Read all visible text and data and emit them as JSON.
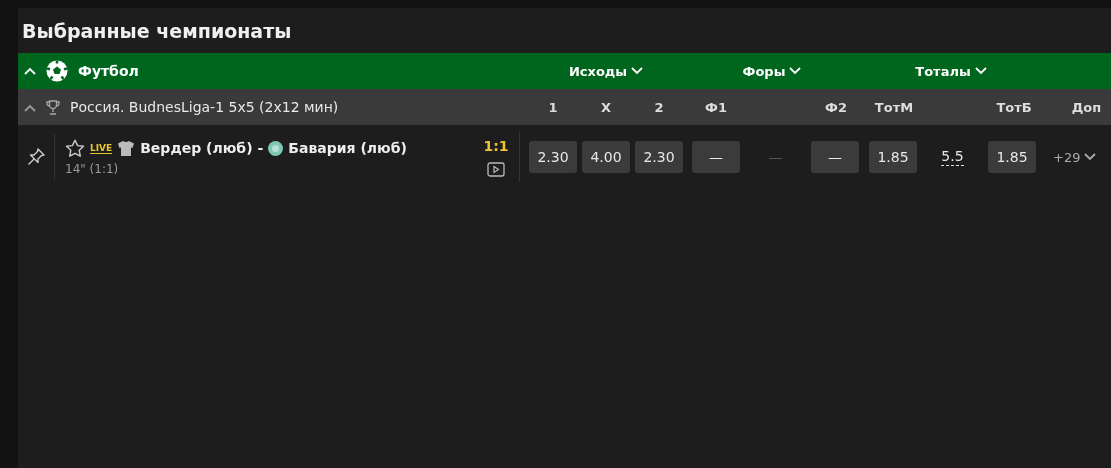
{
  "title": "Выбранные чемпионаты",
  "sport": {
    "name": "Футбол",
    "expanded": true
  },
  "markets": [
    {
      "label": "Исходы"
    },
    {
      "label": "Форы"
    },
    {
      "label": "Тоталы"
    }
  ],
  "league": {
    "name": "Россия. BudnesLiga-1 5x5 (2x12 мин)",
    "expanded": true
  },
  "columns": [
    "1",
    "X",
    "2",
    "Ф1",
    "Ф2",
    "ТотМ",
    "ТотБ",
    "Доп"
  ],
  "match": {
    "pinned": false,
    "favorite": false,
    "live": "LIVE",
    "team1": "Вердер (люб)",
    "separator": "-",
    "team2": "Бавария (люб)",
    "time": "14\" (1:1)",
    "score": "1:1",
    "groups": [
      [
        {
          "kind": "odd",
          "value": "2.30"
        },
        {
          "kind": "odd",
          "value": "4.00"
        },
        {
          "kind": "odd",
          "value": "2.30"
        }
      ],
      [
        {
          "kind": "odd",
          "value": "—"
        },
        {
          "kind": "line",
          "value": "—",
          "disabled": true
        },
        {
          "kind": "odd",
          "value": "—"
        }
      ],
      [
        {
          "kind": "odd",
          "value": "1.85"
        },
        {
          "kind": "line",
          "value": "5.5",
          "disabled": false
        },
        {
          "kind": "odd",
          "value": "1.85"
        }
      ]
    ],
    "more": "+29"
  }
}
